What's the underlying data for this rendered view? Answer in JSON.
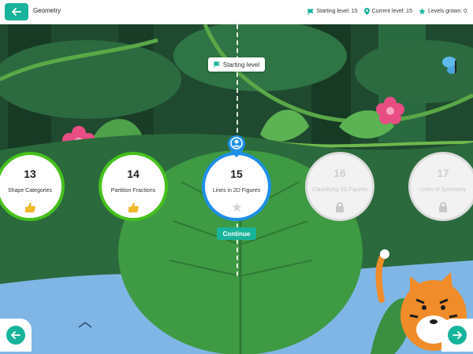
{
  "header": {
    "title": "Geometry",
    "stats": {
      "starting_level": "Starting level: 15",
      "current_level": "Current level: 15",
      "levels_grown": "Levels grown: 0"
    }
  },
  "marker": {
    "label": "Starting level"
  },
  "levels": [
    {
      "number": "13",
      "name": "Shape Categories",
      "status": "completed"
    },
    {
      "number": "14",
      "name": "Partition Fractions",
      "status": "completed"
    },
    {
      "number": "15",
      "name": "Lines in 2D Figures",
      "status": "current"
    },
    {
      "number": "16",
      "name": "Classifying 2D Figures",
      "status": "locked"
    },
    {
      "number": "17",
      "name": "Lines of Symmetry",
      "status": "locked"
    }
  ],
  "continue_label": "Continue",
  "colors": {
    "accent": "#18b39b",
    "completed": "#45c11c",
    "current": "#1e8fe6",
    "locked": "#dcdcdc"
  }
}
